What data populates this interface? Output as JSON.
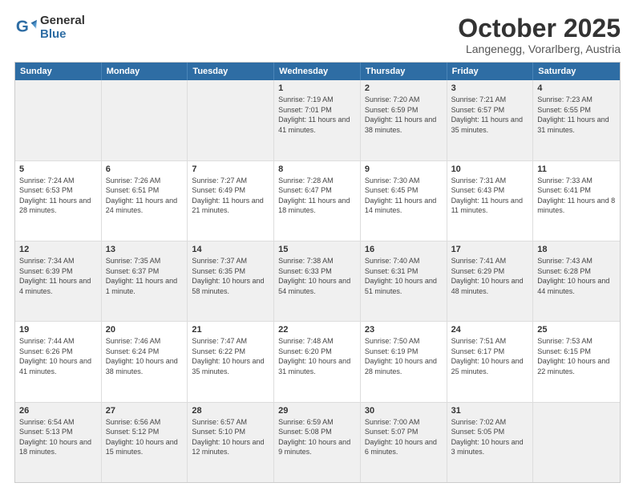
{
  "header": {
    "logo_general": "General",
    "logo_blue": "Blue",
    "month_title": "October 2025",
    "location": "Langenegg, Vorarlberg, Austria"
  },
  "weekdays": [
    "Sunday",
    "Monday",
    "Tuesday",
    "Wednesday",
    "Thursday",
    "Friday",
    "Saturday"
  ],
  "rows": [
    [
      {
        "day": "",
        "info": ""
      },
      {
        "day": "",
        "info": ""
      },
      {
        "day": "",
        "info": ""
      },
      {
        "day": "1",
        "info": "Sunrise: 7:19 AM\nSunset: 7:01 PM\nDaylight: 11 hours and 41 minutes."
      },
      {
        "day": "2",
        "info": "Sunrise: 7:20 AM\nSunset: 6:59 PM\nDaylight: 11 hours and 38 minutes."
      },
      {
        "day": "3",
        "info": "Sunrise: 7:21 AM\nSunset: 6:57 PM\nDaylight: 11 hours and 35 minutes."
      },
      {
        "day": "4",
        "info": "Sunrise: 7:23 AM\nSunset: 6:55 PM\nDaylight: 11 hours and 31 minutes."
      }
    ],
    [
      {
        "day": "5",
        "info": "Sunrise: 7:24 AM\nSunset: 6:53 PM\nDaylight: 11 hours and 28 minutes."
      },
      {
        "day": "6",
        "info": "Sunrise: 7:26 AM\nSunset: 6:51 PM\nDaylight: 11 hours and 24 minutes."
      },
      {
        "day": "7",
        "info": "Sunrise: 7:27 AM\nSunset: 6:49 PM\nDaylight: 11 hours and 21 minutes."
      },
      {
        "day": "8",
        "info": "Sunrise: 7:28 AM\nSunset: 6:47 PM\nDaylight: 11 hours and 18 minutes."
      },
      {
        "day": "9",
        "info": "Sunrise: 7:30 AM\nSunset: 6:45 PM\nDaylight: 11 hours and 14 minutes."
      },
      {
        "day": "10",
        "info": "Sunrise: 7:31 AM\nSunset: 6:43 PM\nDaylight: 11 hours and 11 minutes."
      },
      {
        "day": "11",
        "info": "Sunrise: 7:33 AM\nSunset: 6:41 PM\nDaylight: 11 hours and 8 minutes."
      }
    ],
    [
      {
        "day": "12",
        "info": "Sunrise: 7:34 AM\nSunset: 6:39 PM\nDaylight: 11 hours and 4 minutes."
      },
      {
        "day": "13",
        "info": "Sunrise: 7:35 AM\nSunset: 6:37 PM\nDaylight: 11 hours and 1 minute."
      },
      {
        "day": "14",
        "info": "Sunrise: 7:37 AM\nSunset: 6:35 PM\nDaylight: 10 hours and 58 minutes."
      },
      {
        "day": "15",
        "info": "Sunrise: 7:38 AM\nSunset: 6:33 PM\nDaylight: 10 hours and 54 minutes."
      },
      {
        "day": "16",
        "info": "Sunrise: 7:40 AM\nSunset: 6:31 PM\nDaylight: 10 hours and 51 minutes."
      },
      {
        "day": "17",
        "info": "Sunrise: 7:41 AM\nSunset: 6:29 PM\nDaylight: 10 hours and 48 minutes."
      },
      {
        "day": "18",
        "info": "Sunrise: 7:43 AM\nSunset: 6:28 PM\nDaylight: 10 hours and 44 minutes."
      }
    ],
    [
      {
        "day": "19",
        "info": "Sunrise: 7:44 AM\nSunset: 6:26 PM\nDaylight: 10 hours and 41 minutes."
      },
      {
        "day": "20",
        "info": "Sunrise: 7:46 AM\nSunset: 6:24 PM\nDaylight: 10 hours and 38 minutes."
      },
      {
        "day": "21",
        "info": "Sunrise: 7:47 AM\nSunset: 6:22 PM\nDaylight: 10 hours and 35 minutes."
      },
      {
        "day": "22",
        "info": "Sunrise: 7:48 AM\nSunset: 6:20 PM\nDaylight: 10 hours and 31 minutes."
      },
      {
        "day": "23",
        "info": "Sunrise: 7:50 AM\nSunset: 6:19 PM\nDaylight: 10 hours and 28 minutes."
      },
      {
        "day": "24",
        "info": "Sunrise: 7:51 AM\nSunset: 6:17 PM\nDaylight: 10 hours and 25 minutes."
      },
      {
        "day": "25",
        "info": "Sunrise: 7:53 AM\nSunset: 6:15 PM\nDaylight: 10 hours and 22 minutes."
      }
    ],
    [
      {
        "day": "26",
        "info": "Sunrise: 6:54 AM\nSunset: 5:13 PM\nDaylight: 10 hours and 18 minutes."
      },
      {
        "day": "27",
        "info": "Sunrise: 6:56 AM\nSunset: 5:12 PM\nDaylight: 10 hours and 15 minutes."
      },
      {
        "day": "28",
        "info": "Sunrise: 6:57 AM\nSunset: 5:10 PM\nDaylight: 10 hours and 12 minutes."
      },
      {
        "day": "29",
        "info": "Sunrise: 6:59 AM\nSunset: 5:08 PM\nDaylight: 10 hours and 9 minutes."
      },
      {
        "day": "30",
        "info": "Sunrise: 7:00 AM\nSunset: 5:07 PM\nDaylight: 10 hours and 6 minutes."
      },
      {
        "day": "31",
        "info": "Sunrise: 7:02 AM\nSunset: 5:05 PM\nDaylight: 10 hours and 3 minutes."
      },
      {
        "day": "",
        "info": ""
      }
    ]
  ],
  "alt_rows": [
    0,
    2,
    4
  ]
}
